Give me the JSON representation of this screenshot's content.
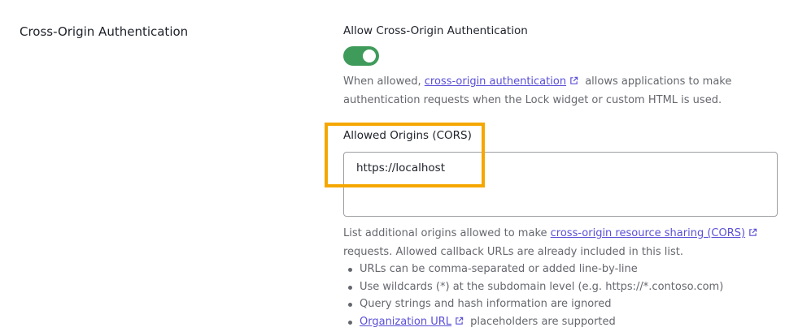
{
  "section": {
    "title": "Cross-Origin Authentication"
  },
  "allow_cors": {
    "label": "Allow Cross-Origin Authentication",
    "enabled": true,
    "help_prefix": "When allowed, ",
    "help_link": "cross-origin authentication",
    "help_suffix": " allows applications to make authentication requests when the Lock widget or custom HTML is used."
  },
  "allowed_origins": {
    "label": "Allowed Origins (CORS)",
    "value": "https://localhost",
    "help_prefix": "List additional origins allowed to make ",
    "help_link": "cross-origin resource sharing (CORS)",
    "help_suffix": " requests. Allowed callback URLs are already included in this list.",
    "bullets": [
      "URLs can be comma-separated or added line-by-line",
      "Use wildcards (*) at the subdomain level (e.g. https://*.contoso.com)",
      "Query strings and hash information are ignored"
    ],
    "last_bullet_link": "Organization URL",
    "last_bullet_suffix": " placeholders are supported"
  },
  "colors": {
    "toggle_on": "#3f9b5a",
    "link": "#5a4fd6",
    "highlight": "#f5a700"
  },
  "icons": {
    "external_link": "external-link-icon"
  }
}
